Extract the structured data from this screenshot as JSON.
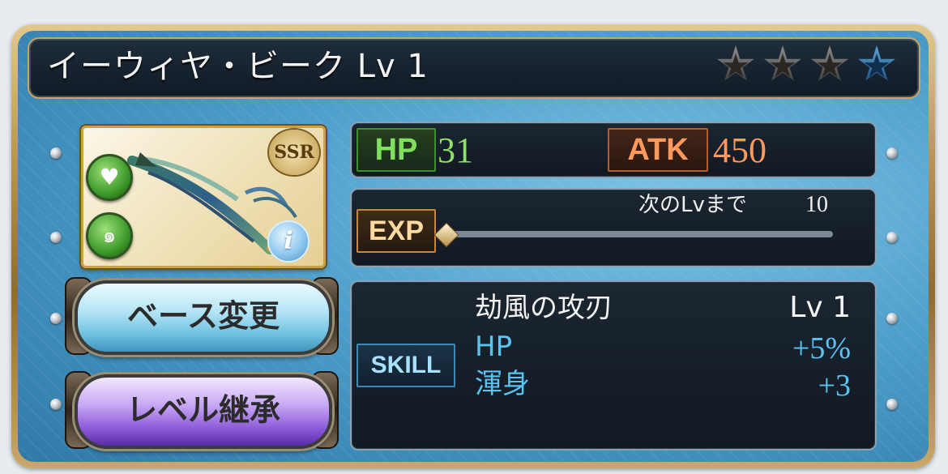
{
  "header": {
    "title": "イーウィヤ・ビーク Lv 1",
    "rarity_stars_filled": 3,
    "rarity_stars_total": 4
  },
  "weapon": {
    "rarity_badge": "SSR",
    "favorite_icon": "heart-icon",
    "element_icon": "wind-element-icon",
    "info_icon": "i"
  },
  "stats": {
    "hp_label": "HP",
    "hp_value": "31",
    "atk_label": "ATK",
    "atk_value": "450"
  },
  "exp": {
    "label": "EXP",
    "next_level_text": "次のLvまで",
    "next_level_value": "10",
    "progress": 0
  },
  "skill": {
    "label": "SKILL",
    "name": "劫風の攻刃",
    "level": "Lv 1",
    "effects": [
      {
        "name": "HP",
        "value": "+5%"
      },
      {
        "name": "渾身",
        "value": "+3"
      }
    ]
  },
  "buttons": {
    "change_base": "ベース変更",
    "inherit_level": "レベル継承"
  },
  "colors": {
    "hp": "#7ee05c",
    "atk": "#ff9a5e",
    "skill_effect": "#59c3f2",
    "frame_gold": "#c7a766"
  }
}
